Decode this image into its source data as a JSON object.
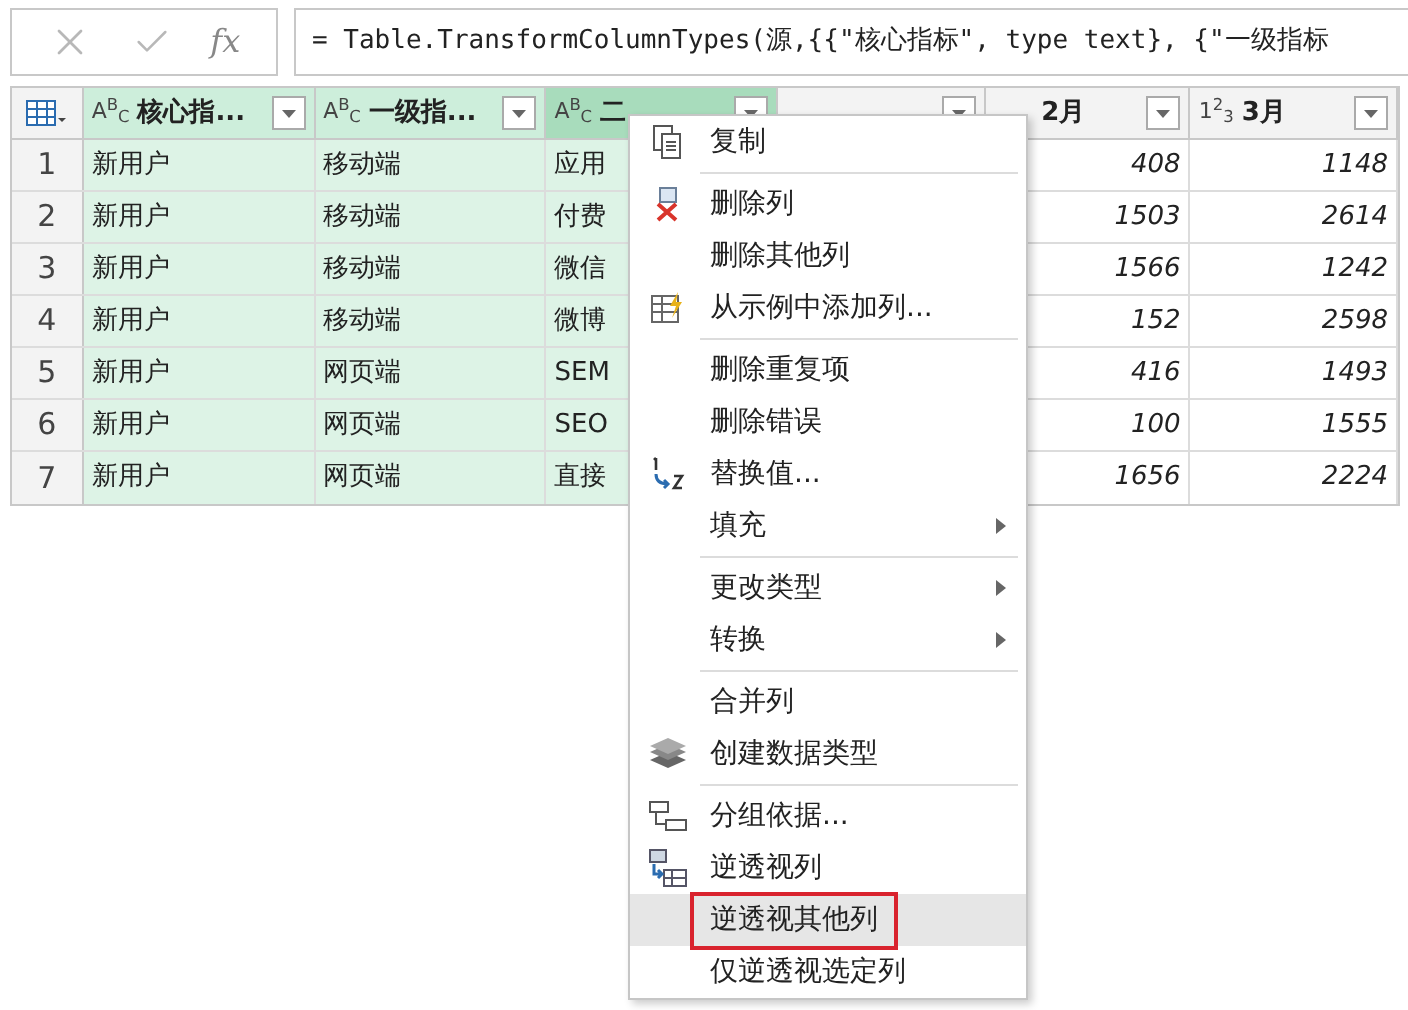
{
  "formula_bar": {
    "fx_label": "fx",
    "formula": "= Table.TransformColumnTypes(源,{{\"核心指标\", type text}, {\"一级指标"
  },
  "table": {
    "columns": [
      {
        "type_label": "A$^{B}$$_{C}$",
        "label": "核心指...",
        "selected": true,
        "focused": false
      },
      {
        "type_label": "A$^{B}$$_{C}$",
        "label": "一级指...",
        "selected": true,
        "focused": false
      },
      {
        "type_label": "A$^{B}$$_{C}$",
        "label": "二",
        "selected": true,
        "focused": true
      },
      {
        "selected": false,
        "focused": false
      },
      {
        "label": "2月",
        "selected": false,
        "focused": false
      },
      {
        "type_label": "1$^{2}$$_{3}$",
        "label": "3月",
        "selected": false,
        "focused": false
      }
    ],
    "rows": [
      {
        "index": "1",
        "cells": [
          "新用户",
          "移动端",
          "应用",
          null,
          "408",
          "1148"
        ]
      },
      {
        "index": "2",
        "cells": [
          "新用户",
          "移动端",
          "付费",
          null,
          "1503",
          "2614"
        ]
      },
      {
        "index": "3",
        "cells": [
          "新用户",
          "移动端",
          "微信",
          null,
          "1566",
          "1242"
        ]
      },
      {
        "index": "4",
        "cells": [
          "新用户",
          "移动端",
          "微博",
          null,
          "152",
          "2598"
        ]
      },
      {
        "index": "5",
        "cells": [
          "新用户",
          "网页端",
          "SEM",
          null,
          "416",
          "1493"
        ]
      },
      {
        "index": "6",
        "cells": [
          "新用户",
          "网页端",
          "SEO",
          null,
          "100",
          "1555"
        ]
      },
      {
        "index": "7",
        "cells": [
          "新用户",
          "网页端",
          "直接",
          null,
          "1656",
          "2224"
        ]
      }
    ]
  },
  "context_menu": {
    "groups": [
      [
        {
          "label": "复制",
          "kind": "copy",
          "submenu": false,
          "selected": false,
          "marked": false
        }
      ],
      [
        {
          "label": "删除列",
          "kind": "delete",
          "submenu": false,
          "selected": false,
          "marked": false
        },
        {
          "label": "删除其他列",
          "kind": "plain",
          "submenu": false,
          "selected": false,
          "marked": false
        },
        {
          "label": "从示例中添加列...",
          "kind": "example",
          "submenu": false,
          "selected": false,
          "marked": false
        }
      ],
      [
        {
          "label": "删除重复项",
          "kind": "plain",
          "submenu": false,
          "selected": false,
          "marked": false
        },
        {
          "label": "删除错误",
          "kind": "plain",
          "submenu": false,
          "selected": false,
          "marked": false
        },
        {
          "label": "替换值...",
          "kind": "replace",
          "submenu": false,
          "selected": false,
          "marked": false
        },
        {
          "label": "填充",
          "kind": "plain",
          "submenu": true,
          "selected": false,
          "marked": false
        }
      ],
      [
        {
          "label": "更改类型",
          "kind": "plain",
          "submenu": true,
          "selected": false,
          "marked": false
        },
        {
          "label": "转换",
          "kind": "plain",
          "submenu": true,
          "selected": false,
          "marked": false
        }
      ],
      [
        {
          "label": "合并列",
          "kind": "plain",
          "submenu": false,
          "selected": false,
          "marked": false
        },
        {
          "label": "创建数据类型",
          "kind": "layers",
          "submenu": false,
          "selected": false,
          "marked": false
        }
      ],
      [
        {
          "label": "分组依据...",
          "kind": "group",
          "submenu": false,
          "selected": false,
          "marked": false
        },
        {
          "label": "逆透视列",
          "kind": "unpivot",
          "submenu": false,
          "selected": false,
          "marked": false
        },
        {
          "label": "逆透视其他列",
          "kind": "plain",
          "submenu": false,
          "selected": true,
          "marked": true
        },
        {
          "label": "仅逆透视选定列",
          "kind": "plain",
          "submenu": false,
          "selected": false,
          "marked": false
        }
      ]
    ]
  }
}
